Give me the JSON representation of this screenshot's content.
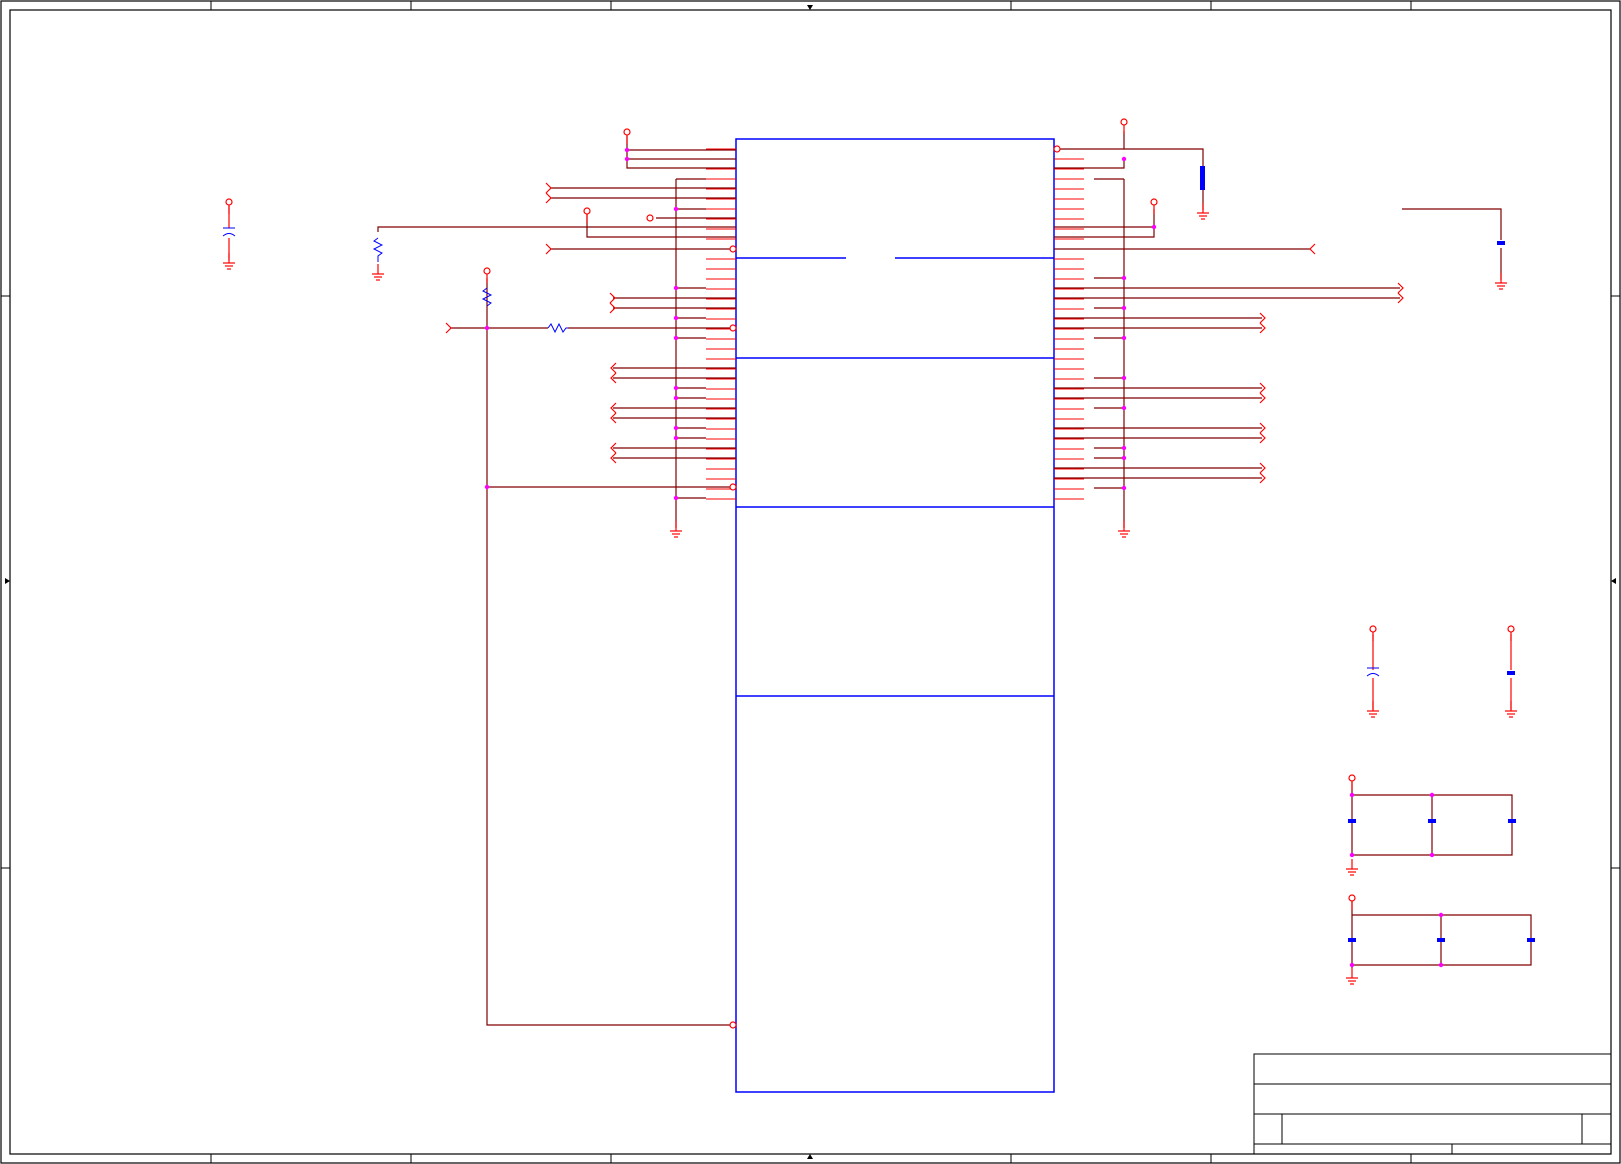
{
  "sheet": {
    "border_labels": []
  },
  "colors": {
    "component_outline": "#0000ff",
    "pin_stub": "#ff0000",
    "wire": "#800000",
    "junction": "#ff00ff",
    "frame": "#000000"
  },
  "title_block": {
    "title": "",
    "document_number": "",
    "revision": "",
    "sheet": ""
  }
}
